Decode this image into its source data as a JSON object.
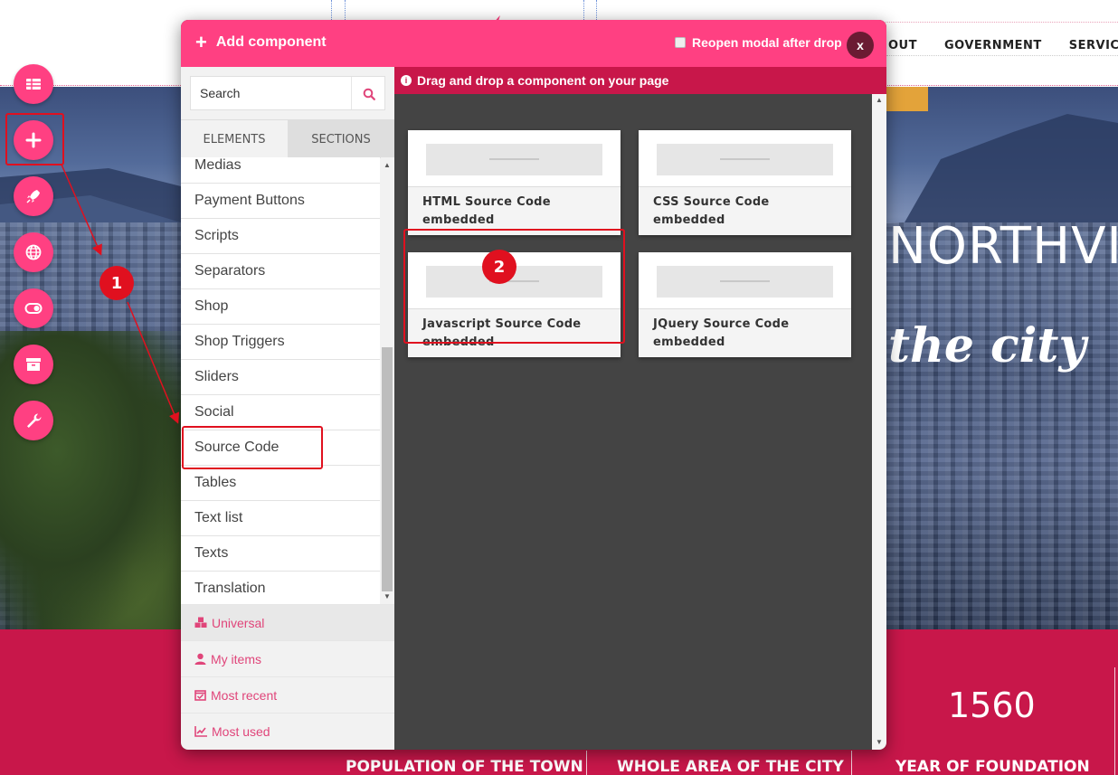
{
  "site": {
    "nav": [
      "OUT",
      "GOVERNMENT",
      "SERVICES"
    ],
    "hero_title": "NORTHVI",
    "hero_script": "the city",
    "stat_number": "1560",
    "stats_labels": [
      "POPULATION OF THE TOWN",
      "WHOLE AREA OF THE CITY",
      "YEAR OF FOUNDATION"
    ]
  },
  "toolbar": {
    "buttons": [
      "grid-icon",
      "plus-icon",
      "rocket-icon",
      "globe-icon",
      "toggle-icon",
      "archive-icon",
      "wrench-icon"
    ]
  },
  "callouts": [
    "1",
    "2"
  ],
  "modal": {
    "title": "Add component",
    "reopen_label": "Reopen modal after drop",
    "close_label": "x",
    "search_placeholder": "Search",
    "tabs": [
      "ELEMENTS",
      "SECTIONS"
    ],
    "categories": [
      "Medias",
      "Payment Buttons",
      "Scripts",
      "Separators",
      "Shop",
      "Shop Triggers",
      "Sliders",
      "Social",
      "Source Code",
      "Tables",
      "Text list",
      "Texts",
      "Translation"
    ],
    "quick_links": [
      "Universal",
      "My items",
      "Most recent",
      "Most used"
    ],
    "info": "Drag and drop a component on your page",
    "components": [
      {
        "title": "HTML Source Code embedded"
      },
      {
        "title": "CSS Source Code embedded"
      },
      {
        "title": "Javascript Source Code embedded"
      },
      {
        "title": "JQuery Source Code embedded"
      }
    ]
  },
  "colors": {
    "accent": "#ff4082",
    "accent_dark": "#c8174a",
    "highlight": "#e0101f",
    "panel_dark": "#444444"
  }
}
